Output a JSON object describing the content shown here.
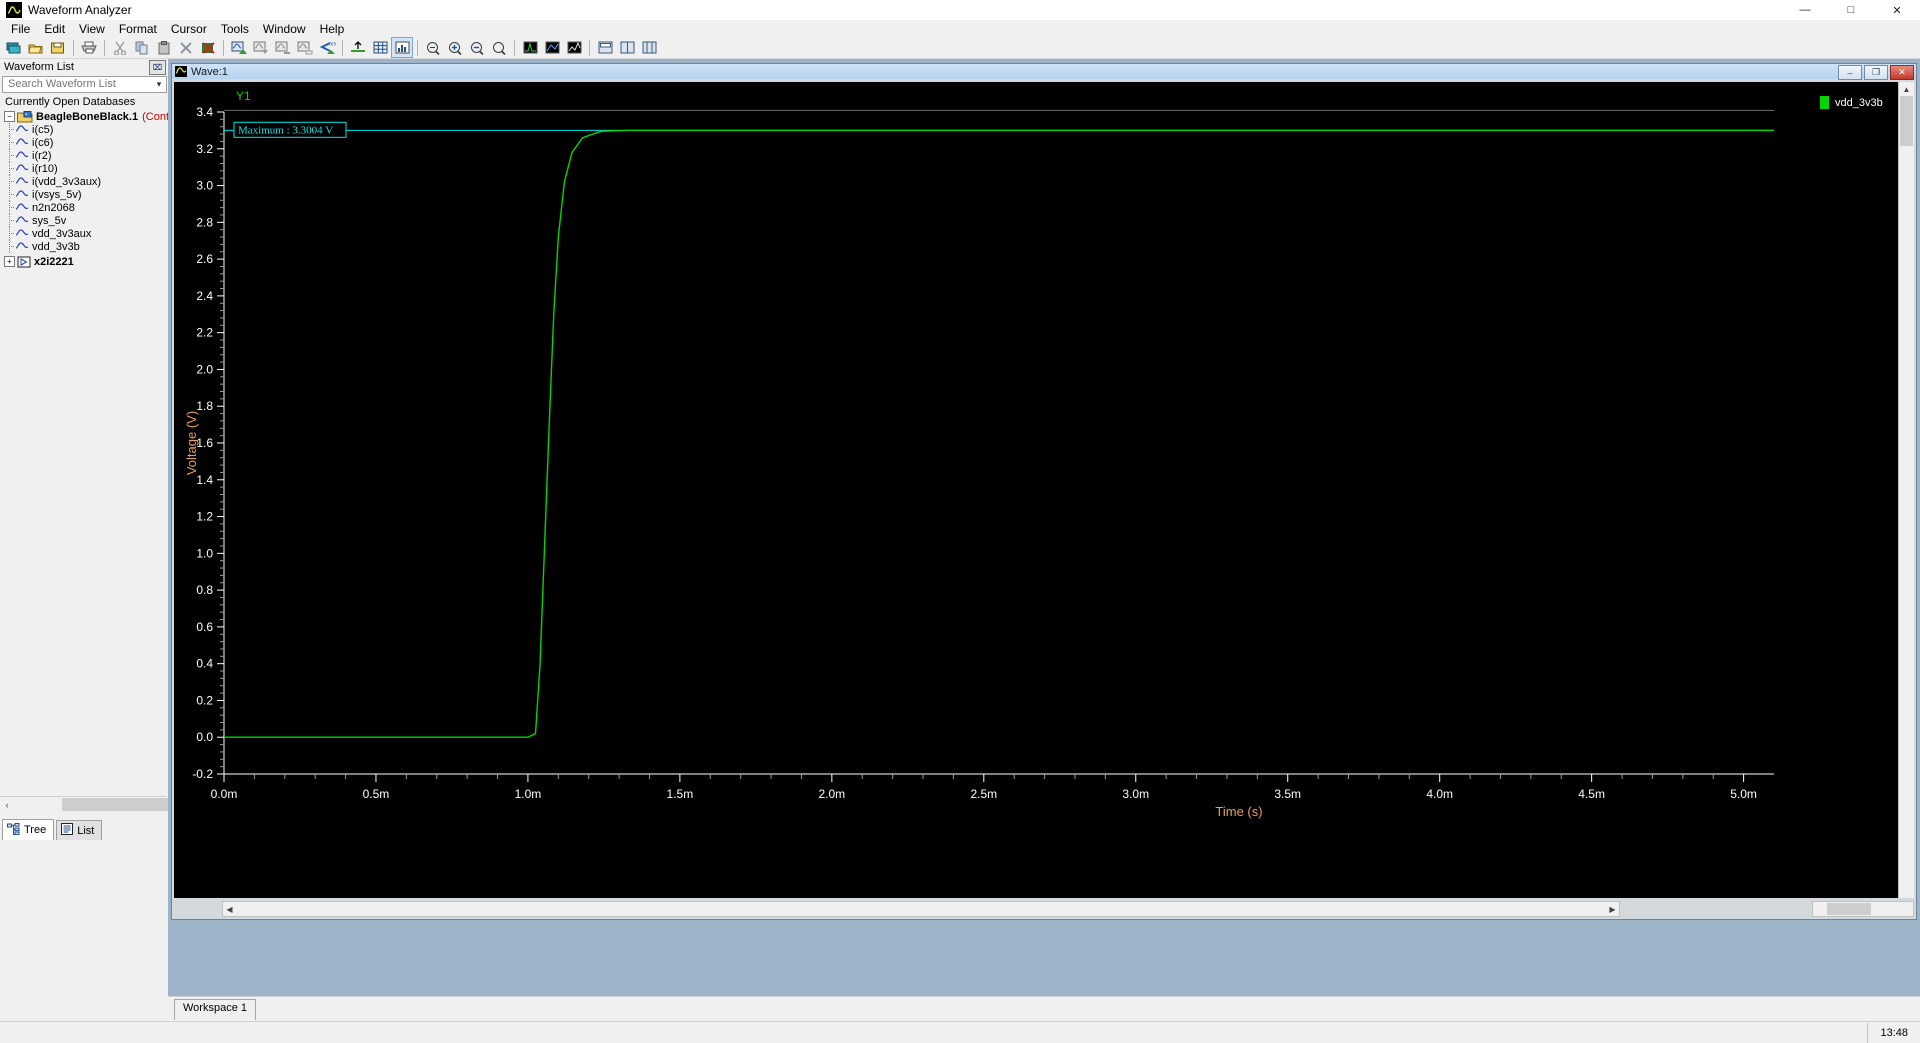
{
  "window": {
    "title": "Waveform Analyzer",
    "app_icon": "waveform-icon",
    "minimize": "—",
    "maximize": "□",
    "close": "✕"
  },
  "menu": {
    "items": [
      "File",
      "Edit",
      "View",
      "Format",
      "Cursor",
      "Tools",
      "Window",
      "Help"
    ]
  },
  "toolbar": {
    "groups": [
      [
        "open-database-icon",
        "open-folder-icon",
        "save-icon"
      ],
      [
        "print-icon"
      ],
      [
        "cut-icon",
        "copy-icon",
        "paste-icon",
        "delete-icon",
        "delete-all-icon"
      ],
      [
        "add-waveform-icon",
        "insert-waveform-icon",
        "append-waveform-icon",
        "overlay-waveform-icon",
        "swap-xy-icon"
      ],
      [
        "baseline-icon",
        "grid-icon",
        "plot-style-icon"
      ],
      [
        "zoom-fit-icon",
        "zoom-in-icon",
        "zoom-out-icon",
        "zoom-reset-icon"
      ],
      [
        "measure-icon",
        "marker-icon",
        "calculator-icon"
      ],
      [
        "tile-horizontal-icon",
        "tile-vertical-icon",
        "cascade-icon"
      ]
    ]
  },
  "sidebar": {
    "panel_title": "Waveform List",
    "collapse_button": "⌧",
    "search": {
      "placeholder": "Search Waveform List",
      "value": "",
      "find_icon": "magnifier-icon",
      "clear_icon": "clear-x-icon",
      "dropdown_icon": "chevron-down-icon"
    },
    "tree_heading": "Currently Open Databases",
    "root": {
      "label": "BeagleBoneBlack.1",
      "note": "(Contai",
      "expanded": true,
      "icon": "database-folder-icon"
    },
    "signals": [
      "i(c5)",
      "i(c6)",
      "i(r2)",
      "i(r10)",
      "i(vdd_3v3aux)",
      "i(vsys_5v)",
      "n2n2068",
      "sys_5v",
      "vdd_3v3aux",
      "vdd_3v3b"
    ],
    "second_node": {
      "label": "x2i2221",
      "expanded": false,
      "icon": "subcircuit-icon"
    },
    "tabs": [
      {
        "label": "Tree",
        "icon": "tree-view-icon",
        "active": true
      },
      {
        "label": "List",
        "icon": "list-view-icon",
        "active": false
      }
    ],
    "hscroll": {
      "left_arrow": "‹",
      "right_arrow": "›"
    }
  },
  "wave_window": {
    "title": "Wave:1",
    "icon": "waveform-icon",
    "minimize": "–",
    "restore": "❐",
    "close": "✕"
  },
  "workspace": {
    "tabs": [
      {
        "label": "Workspace 1",
        "active": true
      }
    ]
  },
  "statusbar": {
    "time": "13:48"
  },
  "chart_data": {
    "type": "line",
    "title": "",
    "axis_group_label": "Y1",
    "xlabel": "Time (s)",
    "ylabel": "Voltage (V)",
    "xlim": [
      0.0,
      0.0051
    ],
    "ylim": [
      -0.2,
      3.4
    ],
    "x_tick_labels": [
      "0.0m",
      "0.5m",
      "1.0m",
      "1.5m",
      "2.0m",
      "2.5m",
      "3.0m",
      "3.5m",
      "4.0m",
      "4.5m",
      "5.0m"
    ],
    "x_tick_values": [
      0.0,
      0.0005,
      0.001,
      0.0015,
      0.002,
      0.0025,
      0.003,
      0.0035,
      0.004,
      0.0045,
      0.005
    ],
    "y_tick_labels": [
      "-0.2",
      "0.0",
      "0.2",
      "0.4",
      "0.6",
      "0.8",
      "1.0",
      "1.2",
      "1.4",
      "1.6",
      "1.8",
      "2.0",
      "2.2",
      "2.4",
      "2.6",
      "2.8",
      "3.0",
      "3.2",
      "3.4"
    ],
    "y_tick_values": [
      -0.2,
      0.0,
      0.2,
      0.4,
      0.6,
      0.8,
      1.0,
      1.2,
      1.4,
      1.6,
      1.8,
      2.0,
      2.2,
      2.4,
      2.6,
      2.8,
      3.0,
      3.2,
      3.4
    ],
    "minor_ticks_per_major": 5,
    "grid": false,
    "background": "#000000",
    "axis_color": "#ffffff",
    "label_color": "#e8a05a",
    "legend_position": "right",
    "series": [
      {
        "name": "vdd_3v3b",
        "color": "#00d700",
        "points": [
          [
            0.0,
            0.0
          ],
          [
            0.001,
            0.0
          ],
          [
            0.001025,
            0.02
          ],
          [
            0.00104,
            0.4
          ],
          [
            0.001055,
            1.05
          ],
          [
            0.00107,
            1.7
          ],
          [
            0.001085,
            2.3
          ],
          [
            0.0011,
            2.72
          ],
          [
            0.00112,
            3.02
          ],
          [
            0.001145,
            3.18
          ],
          [
            0.00118,
            3.26
          ],
          [
            0.00124,
            3.295
          ],
          [
            0.00133,
            3.3004
          ],
          [
            0.0016,
            3.3004
          ],
          [
            0.0051,
            3.3004
          ]
        ]
      }
    ],
    "annotations": [
      {
        "type": "max-marker",
        "label": "Maximum : 3.3004 V",
        "value": 3.3004,
        "color": "#00e5e5",
        "line_from_x": 0.0,
        "line_to_x": 0.0051
      }
    ],
    "legend": [
      {
        "label": "vdd_3v3b",
        "color": "#00d700"
      }
    ],
    "top_reference_line": {
      "y": 3.3004,
      "color": "#6f6f6f"
    }
  }
}
